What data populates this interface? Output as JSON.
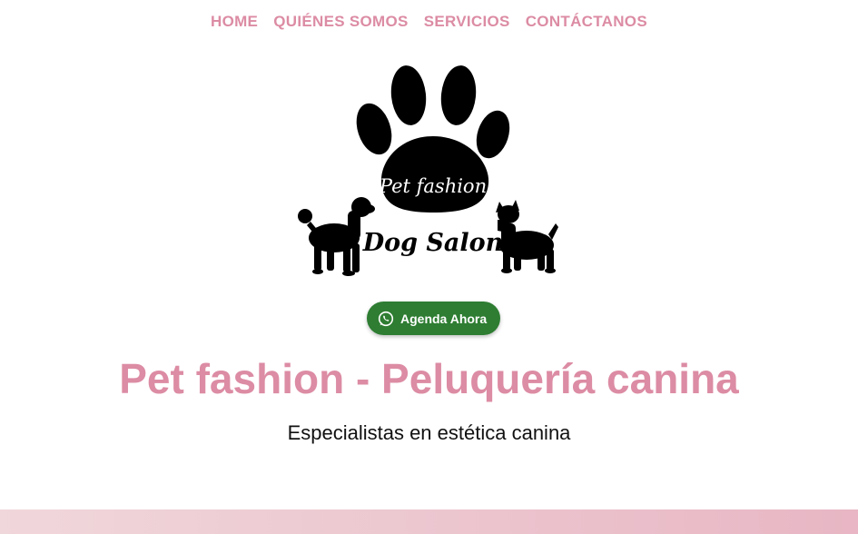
{
  "nav": {
    "items": [
      {
        "label": "HOME"
      },
      {
        "label": "QUIÉNES SOMOS"
      },
      {
        "label": "SERVICIOS"
      },
      {
        "label": "CONTÁCTANOS"
      }
    ]
  },
  "logo": {
    "line1": "Pet fashion",
    "line2": "Dog Salon"
  },
  "cta": {
    "icon": "whatsapp-icon",
    "label": "Agenda Ahora"
  },
  "hero": {
    "title": "Pet fashion - Peluquería canina",
    "subtitle": "Especialistas en estética canina"
  },
  "colors": {
    "accent": "#dc8ca4",
    "button": "#2e7d32"
  }
}
